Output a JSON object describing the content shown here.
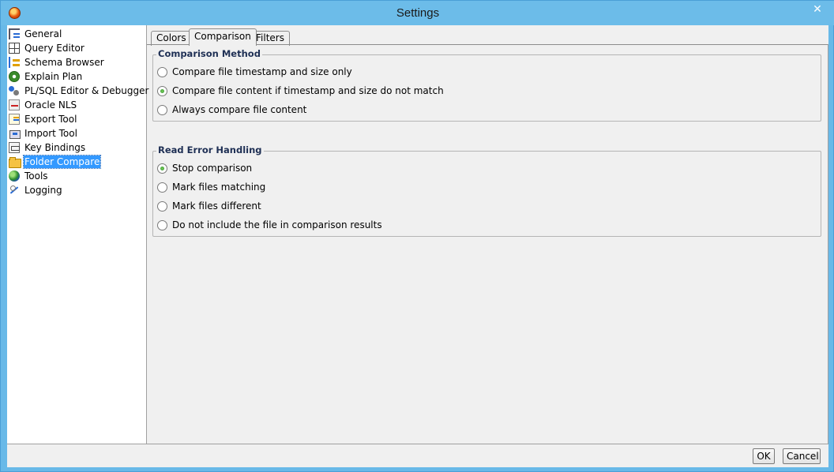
{
  "window": {
    "title": "Settings",
    "close_glyph": "✕"
  },
  "sidebar": {
    "items": [
      {
        "label": "General",
        "icon": "general-icon"
      },
      {
        "label": "Query Editor",
        "icon": "grid-icon"
      },
      {
        "label": "Schema Browser",
        "icon": "schema-icon"
      },
      {
        "label": "Explain Plan",
        "icon": "explain-icon"
      },
      {
        "label": "PL/SQL Editor & Debugger",
        "icon": "plsql-icon"
      },
      {
        "label": "Oracle NLS",
        "icon": "nls-icon"
      },
      {
        "label": "Export Tool",
        "icon": "export-icon"
      },
      {
        "label": "Import Tool",
        "icon": "import-icon"
      },
      {
        "label": "Key Bindings",
        "icon": "key-icon"
      },
      {
        "label": "Folder Compare",
        "icon": "folder-icon",
        "selected": true
      },
      {
        "label": "Tools",
        "icon": "tools-icon"
      },
      {
        "label": "Logging",
        "icon": "logging-icon"
      }
    ]
  },
  "tabs": [
    {
      "label": "Colors"
    },
    {
      "label": "Comparison",
      "active": true
    },
    {
      "label": "Filters"
    }
  ],
  "comparison_method": {
    "title": "Comparison Method",
    "options": [
      {
        "label": "Compare file timestamp and size only",
        "checked": false
      },
      {
        "label": "Compare file content if timestamp and size do not match",
        "checked": true
      },
      {
        "label": "Always compare file content",
        "checked": false
      }
    ]
  },
  "read_error_handling": {
    "title": "Read Error Handling",
    "options": [
      {
        "label": "Stop comparison",
        "checked": true
      },
      {
        "label": "Mark files matching",
        "checked": false
      },
      {
        "label": "Mark files different",
        "checked": false
      },
      {
        "label": "Do not include the file in comparison results",
        "checked": false
      }
    ]
  },
  "footer": {
    "ok_label": "OK",
    "cancel_label": "Cancel"
  },
  "colors": {
    "selection": "#3399ff",
    "titlebar": "#6cbce9",
    "radio_checked": "#2f8f2f"
  }
}
